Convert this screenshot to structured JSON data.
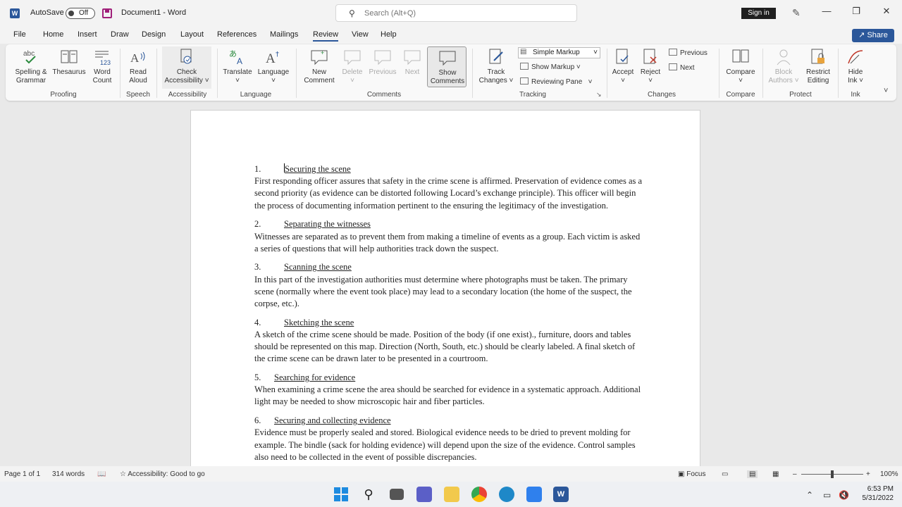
{
  "titlebar": {
    "autosave_label": "AutoSave",
    "autosave_state": "Off",
    "doc_title": "Document1  -  Word",
    "search_placeholder": "Search (Alt+Q)",
    "signin": "Sign in"
  },
  "menu": {
    "tabs": [
      "File",
      "Home",
      "Insert",
      "Draw",
      "Design",
      "Layout",
      "References",
      "Mailings",
      "Review",
      "View",
      "Help"
    ],
    "active": "Review",
    "share": "Share"
  },
  "ribbon": {
    "spelling": [
      "Spelling &",
      "Grammar"
    ],
    "thesaurus": "Thesaurus",
    "wordcount": [
      "Word",
      "Count"
    ],
    "readaloud": [
      "Read",
      "Aloud"
    ],
    "check": [
      "Check",
      "Accessibility"
    ],
    "translate": "Translate",
    "language": "Language",
    "newcomment": [
      "New",
      "Comment"
    ],
    "delete": "Delete",
    "previous": "Previous",
    "next": "Next",
    "showcomments": [
      "Show",
      "Comments"
    ],
    "trackchanges": [
      "Track",
      "Changes"
    ],
    "simplemarkup": "Simple Markup",
    "showmarkup": "Show Markup",
    "reviewingpane": "Reviewing Pane",
    "accept": "Accept",
    "reject": "Reject",
    "prev_change": "Previous",
    "next_change": "Next",
    "compare": "Compare",
    "blockauthors": [
      "Block",
      "Authors"
    ],
    "restrict": [
      "Restrict",
      "Editing"
    ],
    "hideink": [
      "Hide",
      "Ink"
    ],
    "groups": {
      "proofing": "Proofing",
      "speech": "Speech",
      "accessibility": "Accessibility",
      "language": "Language",
      "comments": "Comments",
      "tracking": "Tracking",
      "changes": "Changes",
      "compare": "Compare",
      "protect": "Protect",
      "ink": "Ink"
    }
  },
  "document": {
    "sections": [
      {
        "num": "1.",
        "title": "Securing the scene",
        "body": "First responding officer assures that safety in the crime scene is affirmed. Preservation of evidence comes as a second priority (as evidence can be distorted following Locard’s exchange principle). This officer will begin the process of documenting information pertinent to the ensuring the legitimacy of the investigation."
      },
      {
        "num": "2.",
        "title": "Separating the witnesses",
        "body": "Witnesses are separated as to prevent them from making a timeline of events as a group. Each victim is asked a series of questions that will help authorities track down the suspect."
      },
      {
        "num": "3.",
        "title": "Scanning the scene",
        "body": "In this part of the investigation authorities must determine where photographs must be taken. The primary scene (normally where the event took place) may lead to a secondary location (the home of the suspect, the corpse, etc.)."
      },
      {
        "num": "4.",
        "title": "Sketching the scene",
        "body": "A sketch of the crime scene should be made. Position of the body (if one exist)., furniture, doors and tables should be represented on this map. Direction (North, South, etc.) should be clearly labeled. A final sketch of the crime scene can be drawn later to be presented in a courtroom."
      },
      {
        "num": "5.",
        "title": "Searching for evidence",
        "body": "When examining a crime scene the area should be searched for evidence in a systematic approach. Additional light may be needed to show microscopic hair and fiber particles."
      },
      {
        "num": "6.",
        "title": "Securing and collecting evidence",
        "body": "Evidence must be properly sealed and stored. Biological evidence needs to be dried to prevent molding for example. The bindle (sack for holding evidence) will depend upon the size of the evidence. Control samples also need to be collected in the event of possible discrepancies."
      }
    ]
  },
  "status": {
    "page": "Page 1 of 1",
    "words": "314 words",
    "accessibility": "Accessibility: Good to go",
    "focus": "Focus",
    "zoom": "100%",
    "zoom_level": 1.0
  },
  "taskbar": {
    "time": "6:53 PM",
    "date": "5/31/2022"
  },
  "colors": {
    "accent": "#2b579a",
    "share": "#2b579a",
    "signin": "#1f1f1f"
  }
}
